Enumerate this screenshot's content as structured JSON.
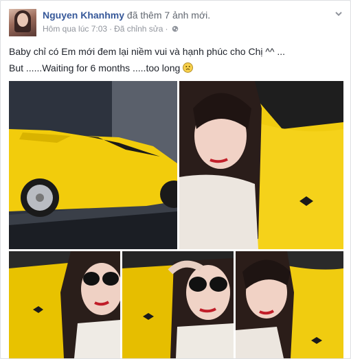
{
  "post": {
    "author": "Nguyen Khanhmy",
    "action": "đã thêm 7 ảnh mới.",
    "time": "Hôm qua lúc 7:03",
    "separator": "·",
    "edited": "Đã chỉnh sửa",
    "separator2": "·",
    "privacy_icon": "globe-icon",
    "menu_icon": "chevron-down-icon",
    "line1": "Baby chỉ có Em mới đem lại niềm vui và hạnh phúc cho Chị ^^ ...",
    "line2": "But ......Waiting for 6 months .....too long",
    "emoji_icon": "frown-emoji-icon"
  },
  "colors": {
    "name_link": "#365899",
    "meta": "#90949c",
    "body_text": "#1d2129",
    "car_yellow": "#f2cc0c"
  }
}
